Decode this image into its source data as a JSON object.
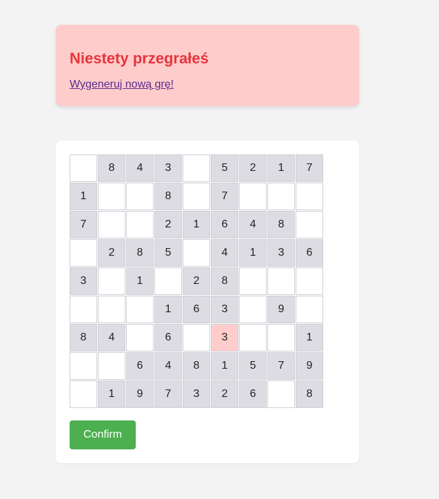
{
  "alert": {
    "title": "Niestety przegrałeś",
    "link": "Wygeneruj nową grę!"
  },
  "board": {
    "rows": [
      [
        "",
        "8",
        "4",
        "3",
        "",
        "5",
        "2",
        "1",
        "7"
      ],
      [
        "1",
        "",
        "",
        "8",
        "",
        "7",
        "",
        "",
        ""
      ],
      [
        "7",
        "",
        "",
        "2",
        "1",
        "6",
        "4",
        "8",
        ""
      ],
      [
        "",
        "2",
        "8",
        "5",
        "",
        "4",
        "1",
        "3",
        "6"
      ],
      [
        "3",
        "",
        "1",
        "",
        "2",
        "8",
        "",
        "",
        ""
      ],
      [
        "",
        "",
        "",
        "1",
        "6",
        "3",
        "",
        "9",
        ""
      ],
      [
        "8",
        "4",
        "",
        "6",
        "",
        "3",
        "",
        "",
        "1"
      ],
      [
        "",
        "",
        "6",
        "4",
        "8",
        "1",
        "5",
        "7",
        "9"
      ],
      [
        "",
        "1",
        "9",
        "7",
        "3",
        "2",
        "6",
        "",
        "8"
      ]
    ],
    "error_cells": [
      [
        6,
        5
      ]
    ]
  },
  "confirm_label": "Confirm",
  "colors": {
    "alert_bg": "#ffcccc",
    "alert_title": "#e8353a",
    "given_cell": "#dcdce2",
    "error_cell": "#ffcccc",
    "confirm_button": "#4caf50"
  }
}
